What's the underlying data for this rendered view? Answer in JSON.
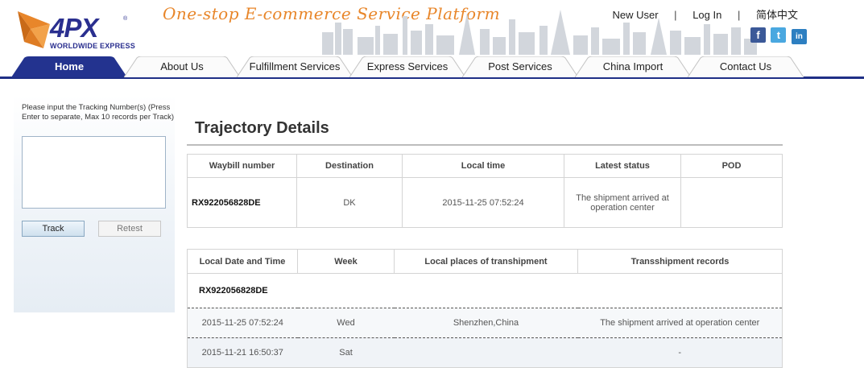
{
  "brand": {
    "logo_text": "4PX",
    "logo_reg": "®",
    "logo_sub": "WORLDWIDE EXPRESS",
    "slogan": "One-stop E-commerce Service Platform",
    "colors": {
      "navy": "#1f2f86",
      "orange": "#e8862a",
      "logo_blue": "#2a2f8f"
    }
  },
  "top_links": {
    "new_user": "New User",
    "sep": "|",
    "log_in": "Log In",
    "language": "简体中文"
  },
  "social": {
    "facebook": {
      "icon": "facebook-icon",
      "glyph": "f"
    },
    "twitter": {
      "icon": "twitter-icon",
      "glyph": "t"
    },
    "linkedin": {
      "icon": "linkedin-icon",
      "glyph": "in"
    }
  },
  "nav": {
    "tabs": [
      {
        "label": "Home",
        "active": true
      },
      {
        "label": "About Us"
      },
      {
        "label": "Fulfillment Services"
      },
      {
        "label": "Express Services"
      },
      {
        "label": "Post Services"
      },
      {
        "label": "China Import"
      },
      {
        "label": "Contact Us"
      }
    ]
  },
  "sidebar": {
    "hint": "Please input the Tracking Number(s) (Press Enter to separate, Max 10 records per Track)",
    "input_value": "",
    "track_label": "Track",
    "retest_label": "Retest"
  },
  "main": {
    "title": "Trajectory Details",
    "summary": {
      "headers": [
        "Waybill number",
        "Destination",
        "Local time",
        "Latest status",
        "POD"
      ],
      "row": [
        "RX922056828DE",
        "DK",
        "2015-11-25 07:52:24",
        "The shipment arrived at operation center",
        ""
      ]
    },
    "details": {
      "headers": [
        "Local Date and Time",
        "Week",
        "Local places of transhipment",
        "Transshipment records"
      ],
      "waybill": "RX922056828DE",
      "rows": [
        [
          "2015-11-25 07:52:24",
          "Wed",
          "Shenzhen,China",
          "The shipment arrived at operation center"
        ],
        [
          "2015-11-21 16:50:37",
          "Sat",
          "",
          "-"
        ]
      ]
    }
  }
}
